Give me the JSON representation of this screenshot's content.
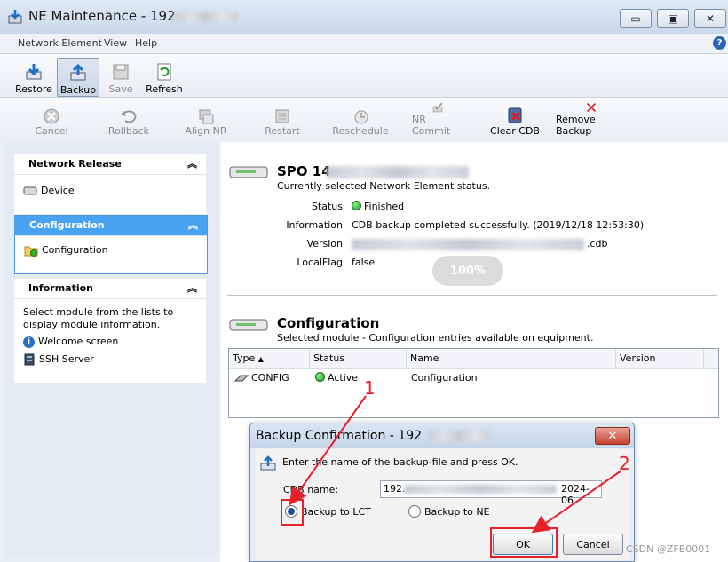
{
  "window": {
    "title": "NE Maintenance - 192",
    "minimize": "▭",
    "maximize": "▣",
    "close": "✕"
  },
  "menu": [
    "Network Element",
    "View",
    "Help"
  ],
  "help_icon": "?",
  "toolbar1": [
    {
      "label": "Restore",
      "icon": "restore-icon"
    },
    {
      "label": "Backup",
      "icon": "backup-icon",
      "pressed": true
    },
    {
      "label": "Save",
      "icon": "save-icon",
      "disabled": true
    },
    {
      "label": "Refresh",
      "icon": "refresh-icon"
    }
  ],
  "toolbar2": [
    {
      "label": "Cancel",
      "icon": "cancel-icon"
    },
    {
      "label": "Rollback",
      "icon": "rollback-icon"
    },
    {
      "label": "Align NR",
      "icon": "align-nr-icon"
    },
    {
      "label": "Restart",
      "icon": "restart-icon"
    },
    {
      "label": "Reschedule",
      "icon": "reschedule-icon"
    },
    {
      "label": "NR Commit",
      "icon": "nr-commit-icon"
    },
    {
      "label": "Clear CDB",
      "icon": "clear-cdb-icon"
    },
    {
      "label": "Remove Backup",
      "icon": "remove-backup-icon"
    }
  ],
  "left": {
    "network_release": {
      "title": "Network Release",
      "items": [
        "Device"
      ]
    },
    "configuration": {
      "title": "Configuration",
      "items": [
        "Configuration"
      ]
    },
    "information": {
      "title": "Information",
      "text": "Select module from the lists to display module information.",
      "items": [
        "Welcome screen",
        "SSH Server"
      ]
    }
  },
  "ne": {
    "name": "SPO 14",
    "subtitle": "Currently selected Network Element status.",
    "fields": [
      {
        "label": "Status",
        "value": "Finished"
      },
      {
        "label": "Information",
        "value": "CDB backup completed successfully. (2019/12/18 12:53:30)"
      },
      {
        "label": "Version",
        "value": ".cdb"
      },
      {
        "label": "LocalFlag",
        "value": "false"
      }
    ],
    "progress_label": "100%",
    "progress": 1.0
  },
  "config": {
    "title": "Configuration",
    "subtitle": "Selected module - Configuration entries available on equipment.",
    "columns": [
      "Type",
      "Status",
      "Name",
      "Version"
    ],
    "rows": [
      {
        "type": "CONFIG",
        "status": "Active",
        "name": "Configuration",
        "version": ""
      }
    ]
  },
  "dialog": {
    "title": "Backup Confirmation - 192",
    "message": "Enter the name of the backup-file and press OK.",
    "cdb_label": "CDB name:",
    "cdb_value_start": "192.",
    "cdb_value_end": "2024-06",
    "radio_lct": "Backup to LCT",
    "radio_ne": "Backup to NE",
    "ok": "OK",
    "cancel": "Cancel",
    "close": "✕"
  },
  "annotations": [
    "1",
    "2"
  ],
  "watermark": "CSDN @ZFB0001"
}
